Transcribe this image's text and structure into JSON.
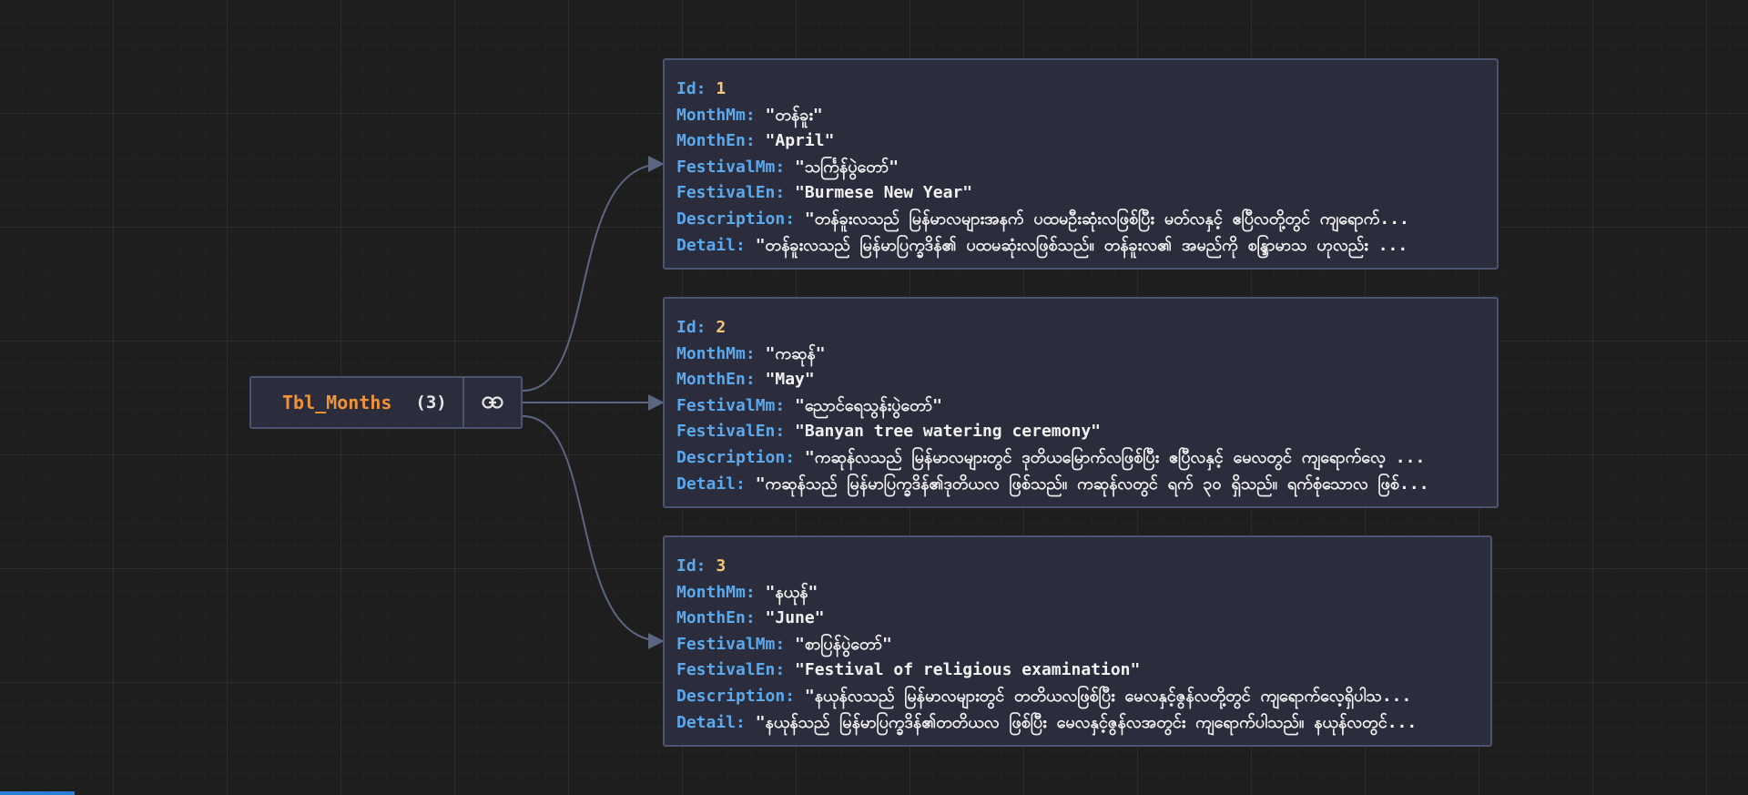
{
  "root": {
    "title": "Tbl_Months",
    "count": "(3)",
    "link_icon": "link-icon"
  },
  "labels": {
    "id": "Id: ",
    "month_mm": "MonthMm: ",
    "month_en": "MonthEn: ",
    "festival_mm": "FestivalMm: ",
    "festival_en": "FestivalEn: ",
    "description": "Description: ",
    "detail": "Detail: "
  },
  "records": [
    {
      "id": "1",
      "month_mm": "\"တန်ခူး\"",
      "month_en": "\"April\"",
      "festival_mm": "\"သင်္ကြန်ပွဲတော်\"",
      "festival_en": "\"Burmese New Year\"",
      "description": "\"တန်ခူးလသည် မြန်မာလများအနက် ပထမဦးဆုံးလဖြစ်ပြီး မတ်လနှင့် ဧပြီလတို့တွင် ကျရောက်...",
      "detail": "\"တန်ခူးလသည် မြန်မာပြက္ခဒိန်၏ ပထမဆုံးလဖြစ်သည်။ တန်ခူးလ၏ အမည်ကို စန္ဒြာမာသ ဟုလည်း ..."
    },
    {
      "id": "2",
      "month_mm": "\"ကဆုန်\"",
      "month_en": "\"May\"",
      "festival_mm": "\"ညောင်ရေသွန်းပွဲတော်\"",
      "festival_en": "\"Banyan tree watering ceremony\"",
      "description": "\"ကဆုန်လသည် မြန်မာလများတွင် ဒုတိယမြောက်လဖြစ်ပြီး ဧပြီလနှင့် မေလတွင် ကျရောက်လေ့ ...",
      "detail": "\"ကဆုန်သည် မြန်မာပြက္ခဒိန်၏ဒုတိယလ ဖြစ်သည်။ ကဆုန်လတွင် ရက် ၃၀ ရှိသည်။ ရက်စုံသောလ ဖြစ်..."
    },
    {
      "id": "3",
      "month_mm": "\"နယုန်\"",
      "month_en": "\"June\"",
      "festival_mm": "\"စာပြန်ပွဲတော်\"",
      "festival_en": "\"Festival of religious examination\"",
      "description": "\"နယုန်လသည် မြန်မာလများတွင် တတိယလဖြစ်ပြီး မေလနှင့်ဇွန်လတို့တွင် ကျရောက်လေ့ရှိပါသ...",
      "detail": "\"နယုန်သည် မြန်မာပြက္ခဒိန်၏တတိယလ ဖြစ်ပြီး မေလနှင့်ဇွန်လအတွင်း ကျရောက်ပါသည်။ နယုန်လတွင်..."
    }
  ]
}
